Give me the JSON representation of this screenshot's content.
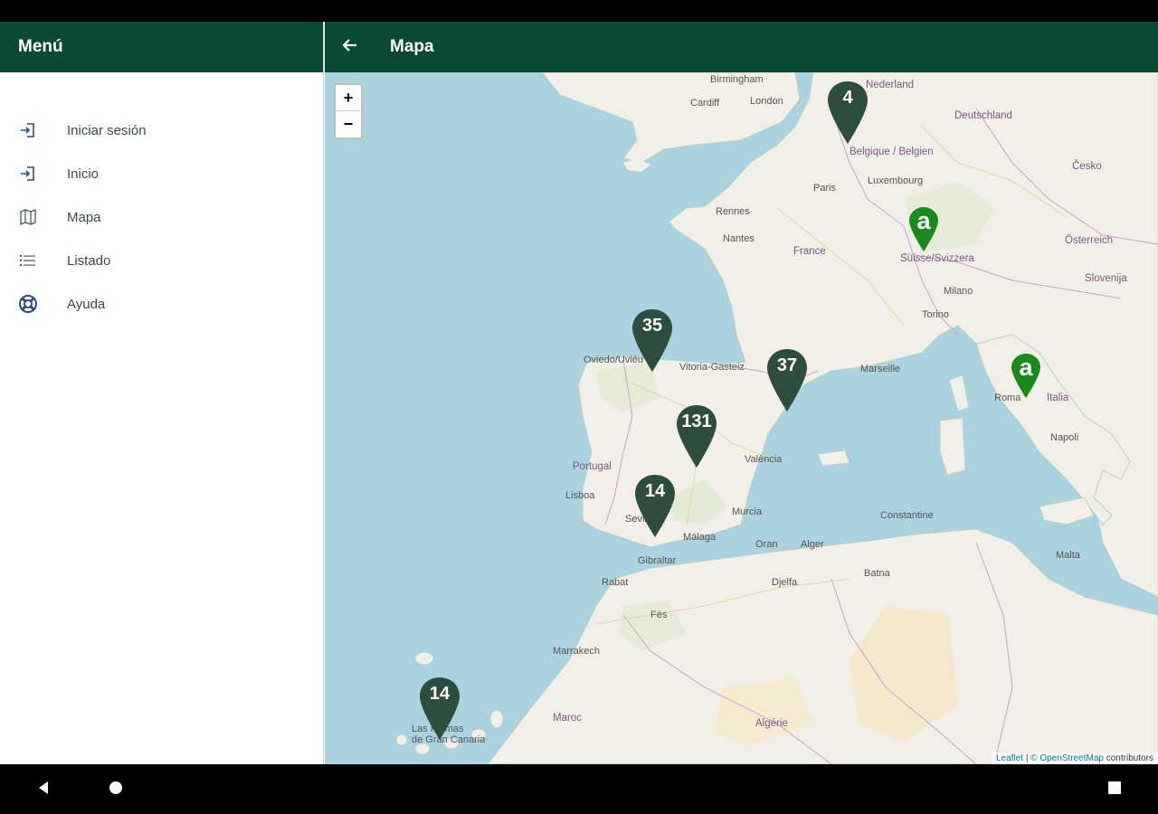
{
  "drawer": {
    "title": "Menú",
    "items": [
      {
        "label": "Iniciar sesión",
        "icon": "login-icon"
      },
      {
        "label": "Inicio",
        "icon": "login-icon"
      },
      {
        "label": "Mapa",
        "icon": "map-icon"
      },
      {
        "label": "Listado",
        "icon": "list-icon"
      },
      {
        "label": "Ayuda",
        "icon": "lifebuoy-icon"
      }
    ]
  },
  "appbar": {
    "title": "Mapa",
    "back_icon": "arrow-back-icon"
  },
  "map": {
    "zoom_in": "+",
    "zoom_out": "−",
    "clusters": [
      "4",
      "35",
      "37",
      "131",
      "14",
      "14"
    ],
    "single_marker_label": "a",
    "labels": {
      "birmingham": "Birmingham",
      "london": "London",
      "cardiff": "Cardiff",
      "nederland": "Nederland",
      "belgique": "Belgique /\nBelgien",
      "luxembourg": "Luxembourg",
      "deutschland": "Deutschland",
      "france": "France",
      "paris": "Paris",
      "nantes": "Nantes",
      "rennes": "Rennes",
      "suisse": "Suisse/Svizzera",
      "italia": "Italia",
      "roma": "Roma",
      "portugal": "Portugal",
      "lisboa": "Lisboa",
      "sevilla": "Sevilla",
      "malaga": "Málaga",
      "murcia": "Murcia",
      "valencia": "València",
      "marseille": "Marseille",
      "torino": "Torino",
      "milano": "Milano",
      "napoli": "Napoli",
      "alger": "Alger",
      "oran": "Oran",
      "rabat": "Rabat",
      "fes": "Fès",
      "marrakech": "Marrakech",
      "maroc": "Maroc",
      "algerie": "Algérie",
      "las_palmas": "Las Palmas\nde Gran Canaria",
      "gibraltar": "Gibraltar",
      "oviedo": "Oviedo/Uviéu",
      "vitoria": "Vitoria-Gasteiz",
      "slovenija": "Slovenija",
      "cesko": "Česko",
      "osterreich": "Österreich",
      "constantine": "Constantine",
      "batna": "Batna",
      "djelfa": "Djelfa",
      "malta": "Malta"
    },
    "attribution_leaflet": "Leaflet",
    "attribution_osm": "© OpenStreetMap",
    "attribution_tail": "contributors"
  },
  "colors": {
    "primary": "#0a4a35",
    "cluster": "#2d4d3d",
    "single_marker": "#1a8a1a",
    "sea": "#aad3df",
    "land": "#f2efe9"
  }
}
